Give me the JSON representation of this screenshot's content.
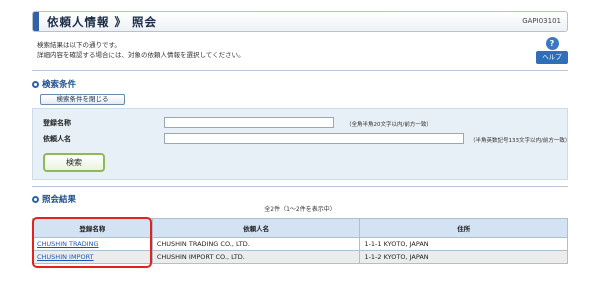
{
  "header": {
    "title": "依頼人情報 》 照会",
    "screen_id": "GAPI03101"
  },
  "intro": {
    "line1": "検索結果は以下の通りです。",
    "line2": "詳細内容を確認する場合には、対象の依頼人情報を選択してください。"
  },
  "help": {
    "icon": "?",
    "label": "ヘルプ"
  },
  "search": {
    "heading": "検索条件",
    "close_label": "検索条件を閉じる",
    "fields": [
      {
        "label": "登録名称",
        "value": "",
        "hint": "（全角半角20文字以内/前方一致）"
      },
      {
        "label": "依頼人名",
        "value": "",
        "hint": "（半角英数記号133文字以内/前方一致）"
      }
    ],
    "button_label": "検索"
  },
  "results": {
    "heading": "照会結果",
    "count_text": "全2件（1～2件を表示中）",
    "columns": [
      "登録名称",
      "依頼人名",
      "住所"
    ],
    "rows": [
      {
        "reg_name": "CHUSHIN TRADING",
        "client_name": "CHUSHIN TRADING CO., LTD.",
        "address": "1-1-1 KYOTO, JAPAN"
      },
      {
        "reg_name": "CHUSHIN IMPORT",
        "client_name": "CHUSHIN IMPORT CO., LTD.",
        "address": "1-1-2 KYOTO, JAPAN"
      }
    ]
  },
  "colors": {
    "accent": "#2f63a6",
    "link": "#1a57b8",
    "highlight": "#e0231f",
    "panel": "#e7f0f7",
    "header_cell": "#d3e3f3"
  }
}
